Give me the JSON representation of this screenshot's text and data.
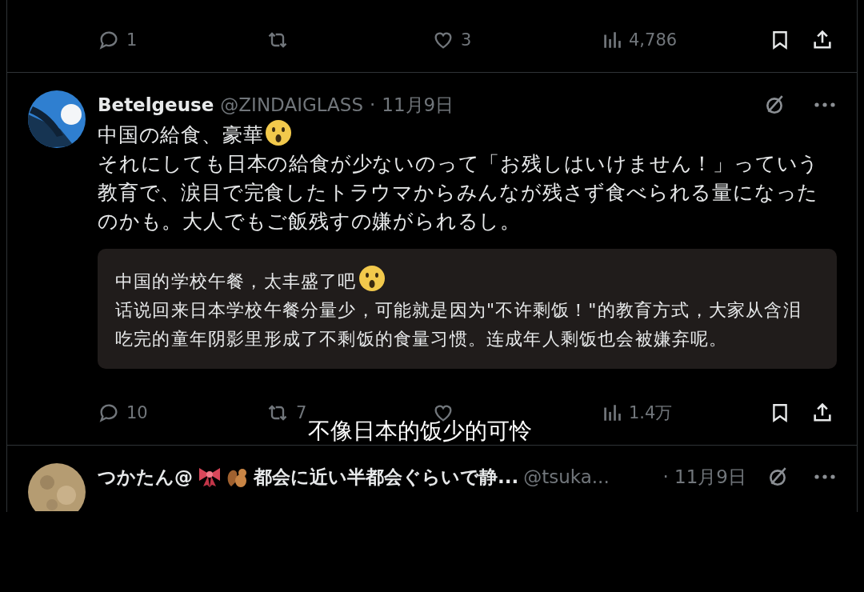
{
  "top_actions": {
    "replies": "1",
    "likes": "3",
    "views": "4,786"
  },
  "tweet": {
    "display_name": "Betelgeuse",
    "handle": "@ZINDAIGLASS",
    "separator": "·",
    "date": "11月9日",
    "paragraphs": [
      {
        "text": "中国の給食、豪華",
        "emoji": true
      },
      {
        "text": "それにしても日本の給食が少ないのって「お残しはいけません！」っていう教育で、涙目で完食したトラウマからみんなが残さず食べられる量になったのかも。大人でもご飯残すの嫌がられるし。",
        "emoji": false
      }
    ],
    "translation": [
      {
        "text": "中国的学校午餐，太丰盛了吧",
        "emoji": true
      },
      {
        "text": "话说回来日本学校午餐分量少，可能就是因为\"不许剩饭！\"的教育方式，大家从含泪吃完的童年阴影里形成了不剩饭的食量习惯。连成年人剩饭也会被嫌弃呢。",
        "emoji": false
      }
    ],
    "actions": {
      "replies": "10",
      "reposts": "7",
      "views": "1.4万"
    }
  },
  "next_tweet": {
    "name_start": "つかたん@",
    "name_end": "都会に近い半都会ぐらいで静...",
    "handle": "@tsuka...",
    "date": "· 11月9日"
  },
  "subtitle": "不像日本的饭少的可怜"
}
